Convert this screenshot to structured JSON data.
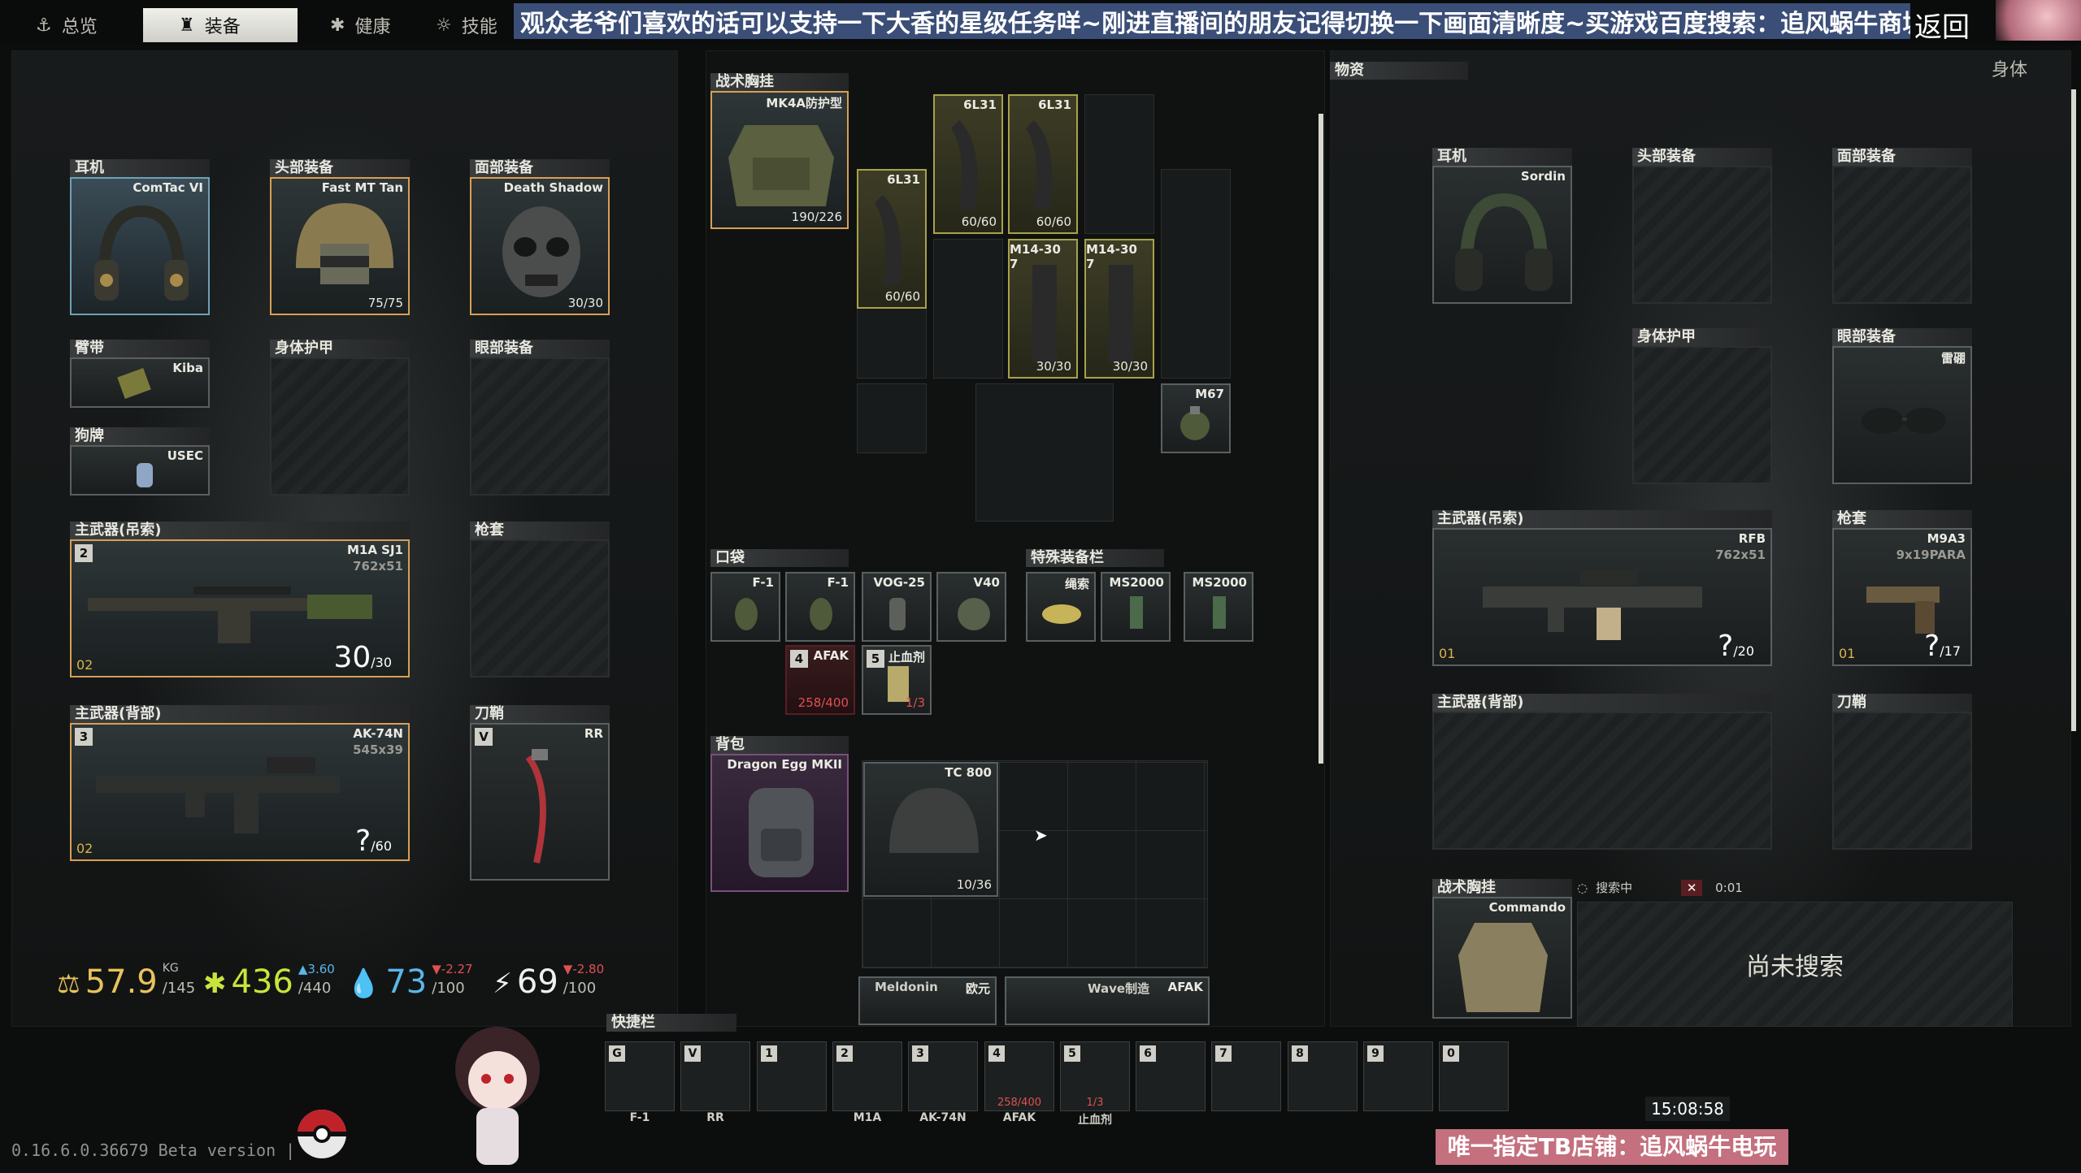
{
  "tabs": [
    {
      "label": "总览",
      "icon": "person-icon",
      "active": false
    },
    {
      "label": "装备",
      "icon": "backpack-icon",
      "active": true
    },
    {
      "label": "健康",
      "icon": "health-icon",
      "active": false
    },
    {
      "label": "技能",
      "icon": "skills-icon",
      "active": false
    }
  ],
  "banner": "观众老爷们喜欢的话可以支持一下大香的星级任务咩~刚进直播间的朋友记得切换一下画面清晰度~买游戏百度搜索：追风蜗牛商城",
  "back_label": "返回",
  "body_label": "身体",
  "left": {
    "earpiece": {
      "title": "耳机",
      "item": "ComTac VI"
    },
    "headwear": {
      "title": "头部装备",
      "item": "Fast MT Tan",
      "durability": "75/75"
    },
    "face": {
      "title": "面部装备",
      "item": "Death Shadow",
      "durability": "30/30"
    },
    "armband": {
      "title": "臂带",
      "item": "Kiba"
    },
    "body_armor": {
      "title": "身体护甲"
    },
    "eyewear": {
      "title": "眼部装备"
    },
    "dogtag": {
      "title": "狗牌",
      "item": "USEC"
    },
    "primary_sling": {
      "title": "主武器(吊索)",
      "item": "M1A SJ1",
      "caliber": "762x51",
      "ammo": "30",
      "ammo_max": "/30",
      "slot_key": "2",
      "level": "02"
    },
    "holster": {
      "title": "枪套"
    },
    "primary_back": {
      "title": "主武器(背部)",
      "item": "AK-74N",
      "caliber": "545x39",
      "ammo": "?",
      "ammo_max": "/60",
      "slot_key": "3",
      "level": "02"
    },
    "scabbard": {
      "title": "刀鞘",
      "item": "RR",
      "slot_key": "V"
    }
  },
  "stats": {
    "weight": "57.9",
    "weight_unit": "KG",
    "weight_max": "/145",
    "health": "436",
    "health_max": "/440",
    "health_delta": "▲3.60",
    "hydration": "73",
    "hydration_max": "/100",
    "hydration_delta": "▼-2.27",
    "energy": "69",
    "energy_max": "/100",
    "energy_delta": "▼-2.80"
  },
  "mid": {
    "rig": {
      "title": "战术胸挂",
      "item": "MK4A防护型",
      "durability": "190/226"
    },
    "rig_mags": [
      {
        "name": "6L31",
        "count": "60/60"
      },
      {
        "name": "6L31",
        "count": "60/60"
      },
      {
        "name": "6L31",
        "count": "60/60"
      },
      {
        "name": "M14-30 7",
        "count": "30/30"
      },
      {
        "name": "M14-30 7",
        "count": "30/30"
      },
      {
        "name": "M67",
        "count": ""
      }
    ],
    "pockets": {
      "title": "口袋",
      "items": [
        "F-1",
        "F-1",
        "VOG-25",
        "V40"
      ]
    },
    "pocket_meds": [
      {
        "key": "4",
        "name": "AFAK",
        "count": "258/400"
      },
      {
        "key": "5",
        "name": "止血剂",
        "count": "1/3"
      }
    ],
    "special": {
      "title": "特殊装备栏",
      "items": [
        "绳索",
        "MS2000",
        "MS2000"
      ]
    },
    "backpack": {
      "title": "背包",
      "item": "Dragon Egg MKII"
    },
    "backpack_items": [
      {
        "name": "TC 800",
        "count": "10/36"
      },
      {
        "name": "Meldonin"
      },
      {
        "name": "欧元"
      },
      {
        "name": "Wave制造"
      },
      {
        "name": "AFAK"
      }
    ]
  },
  "right": {
    "title": "物资",
    "earpiece": {
      "title": "耳机",
      "item": "Sordin"
    },
    "headwear": {
      "title": "头部装备"
    },
    "face": {
      "title": "面部装备"
    },
    "body_armor": {
      "title": "身体护甲"
    },
    "eyewear": {
      "title": "眼部装备",
      "item": "雷硼"
    },
    "primary_sling": {
      "title": "主武器(吊索)",
      "item": "RFB",
      "caliber": "762x51",
      "ammo": "?",
      "ammo_max": "/20",
      "level": "01"
    },
    "holster": {
      "title": "枪套",
      "item": "M9A3",
      "caliber": "9x19PARA",
      "ammo": "?",
      "ammo_max": "/17",
      "level": "01"
    },
    "primary_back": {
      "title": "主武器(背部)"
    },
    "scabbard": {
      "title": "刀鞘"
    },
    "rig": {
      "title": "战术胸挂",
      "item": "Commando"
    },
    "search_status": "搜索中",
    "search_time": "0:01",
    "not_searched": "尚未搜索"
  },
  "hotbar": {
    "title": "快捷栏",
    "slots": [
      {
        "key": "G",
        "label": "F-1",
        "count": ""
      },
      {
        "key": "V",
        "label": "RR",
        "count": ""
      },
      {
        "key": "1",
        "label": "",
        "count": ""
      },
      {
        "key": "2",
        "label": "M1A",
        "count": ""
      },
      {
        "key": "3",
        "label": "AK-74N",
        "count": ""
      },
      {
        "key": "4",
        "label": "AFAK",
        "count": "258/400"
      },
      {
        "key": "5",
        "label": "止血剂",
        "count": "1/3"
      },
      {
        "key": "6",
        "label": "",
        "count": ""
      },
      {
        "key": "7",
        "label": "",
        "count": ""
      },
      {
        "key": "8",
        "label": "",
        "count": ""
      },
      {
        "key": "9",
        "label": "",
        "count": ""
      },
      {
        "key": "0",
        "label": "",
        "count": ""
      }
    ]
  },
  "version": "0.16.6.0.36679 Beta version |",
  "clock": "15:08:58",
  "tb_shop": "唯一指定TB店铺：追风蜗牛电玩",
  "colors": {
    "accent": "#d79f55",
    "banner": "#3a4e77",
    "health": "#c9e53a",
    "hydration": "#5bb6e8",
    "energy": "#f0f0f0",
    "weight": "#e8c35a",
    "shop": "#c4707f"
  }
}
